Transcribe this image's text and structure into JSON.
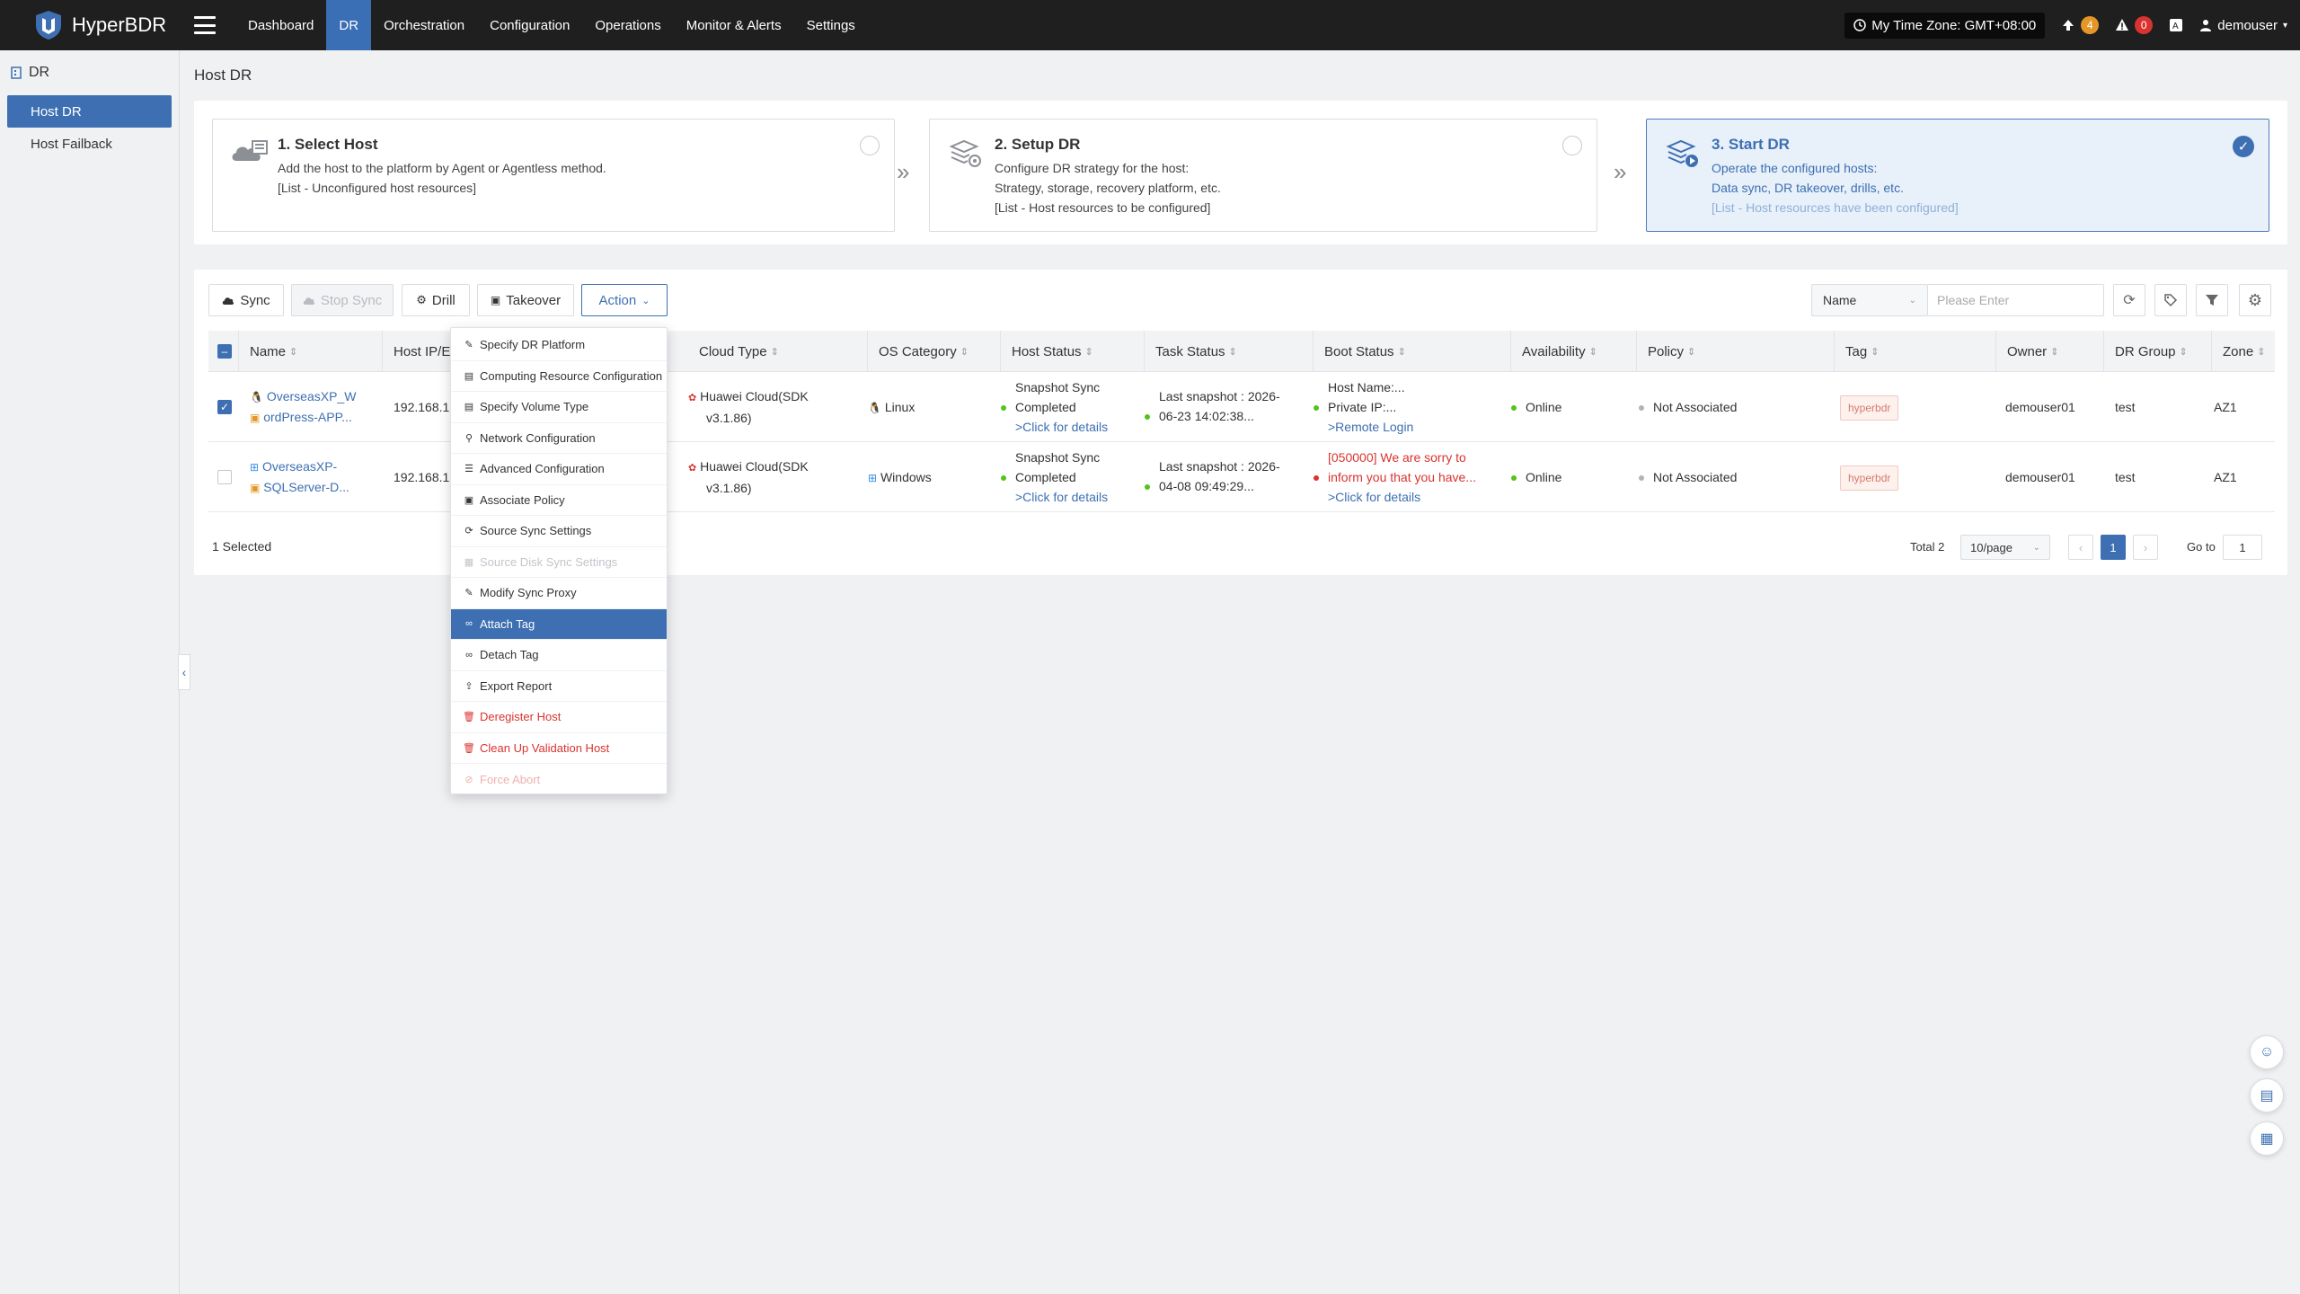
{
  "app": {
    "title": "HyperBDR"
  },
  "nav": [
    {
      "label": "Dashboard"
    },
    {
      "label": "DR"
    },
    {
      "label": "Orchestration"
    },
    {
      "label": "Configuration"
    },
    {
      "label": "Operations"
    },
    {
      "label": "Monitor & Alerts"
    },
    {
      "label": "Settings"
    }
  ],
  "header": {
    "timezone": "My Time Zone: GMT+08:00",
    "upload_count": "4",
    "alert_count": "0",
    "user": "demouser"
  },
  "sidebar": {
    "section": "DR",
    "items": [
      {
        "label": "Host DR"
      },
      {
        "label": "Host Failback"
      }
    ]
  },
  "page": {
    "title": "Host DR"
  },
  "steps": [
    {
      "title": "1. Select Host",
      "lines": [
        "Add the host to the platform by Agent or Agentless method.",
        "[List - Unconfigured host resources]"
      ]
    },
    {
      "title": "2. Setup DR",
      "lines": [
        "Configure DR strategy for the host:",
        "Strategy, storage, recovery platform, etc.",
        "[List - Host resources to be configured]"
      ]
    },
    {
      "title": "3. Start DR",
      "lines": [
        "Operate the configured hosts:",
        "Data sync, DR takeover, drills, etc.",
        "[List - Host resources have been configured]"
      ]
    }
  ],
  "toolbar": {
    "sync": "Sync",
    "stop_sync": "Stop Sync",
    "drill": "Drill",
    "takeover": "Takeover",
    "action": "Action",
    "filter_field": "Name",
    "search_placeholder": "Please Enter"
  },
  "table": {
    "columns": [
      "Name",
      "Host IP/ESXi",
      "Cloud Type",
      "OS Category",
      "Host Status",
      "Task Status",
      "Boot Status",
      "Availability",
      "Policy",
      "Tag",
      "Owner",
      "DR Group",
      "Zone"
    ],
    "rows": [
      {
        "checked": true,
        "name_line1": "OverseasXP_W",
        "name_line2": "ordPress-APP...",
        "ip": "192.168.1",
        "cloud_line1": "Huawei Cloud(SDK",
        "cloud_line2": "v3.1.86)",
        "os": "Linux",
        "host_status_line1": "Snapshot Sync",
        "host_status_line2": "Completed",
        "host_status_link": ">Click for details",
        "task_line1": "Last snapshot : 2026-",
        "task_line2": "06-23 14:02:38...",
        "boot_line1": "Host Name:...",
        "boot_line2": "Private IP:...",
        "boot_link": ">Remote Login",
        "availability": "Online",
        "policy": "Not Associated",
        "tag": "hyperbdr",
        "owner": "demouser01",
        "group": "test",
        "zone": "AZ1"
      },
      {
        "checked": false,
        "name_line1": "OverseasXP-",
        "name_line2": "SQLServer-D...",
        "ip": "192.168.1",
        "cloud_line1": "Huawei Cloud(SDK",
        "cloud_line2": "v3.1.86)",
        "os": "Windows",
        "host_status_line1": "Snapshot Sync",
        "host_status_line2": "Completed",
        "host_status_link": ">Click for details",
        "task_line1": "Last snapshot : 2026-",
        "task_line2": "04-08 09:49:29...",
        "boot_line1": "[050000] We are sorry to",
        "boot_line2": "inform you that you have...",
        "boot_link": ">Click for details",
        "availability": "Online",
        "policy": "Not Associated",
        "tag": "hyperbdr",
        "owner": "demouser01",
        "group": "test",
        "zone": "AZ1"
      }
    ]
  },
  "footer": {
    "selected": "1 Selected",
    "total": "Total 2",
    "page_size": "10/page",
    "current_page": "1",
    "goto_label": "Go to",
    "goto_value": "1"
  },
  "action_menu": [
    {
      "label": "Specify DR Platform",
      "icon": "edit-icon"
    },
    {
      "label": "Computing Resource Configuration",
      "icon": "server-icon"
    },
    {
      "label": "Specify Volume Type",
      "icon": "disk-icon"
    },
    {
      "label": "Network Configuration",
      "icon": "network-icon"
    },
    {
      "label": "Advanced Configuration",
      "icon": "sliders-icon"
    },
    {
      "label": "Associate Policy",
      "icon": "policy-icon"
    },
    {
      "label": "Source Sync Settings",
      "icon": "sync-settings-icon"
    },
    {
      "label": "Source Disk Sync Settings",
      "icon": "disk-sync-icon"
    },
    {
      "label": "Modify Sync Proxy",
      "icon": "proxy-icon"
    },
    {
      "label": "Attach Tag",
      "icon": "link-icon"
    },
    {
      "label": "Detach Tag",
      "icon": "unlink-icon"
    },
    {
      "label": "Export Report",
      "icon": "export-icon"
    },
    {
      "label": "Deregister Host",
      "icon": "trash-icon"
    },
    {
      "label": "Clean Up Validation Host",
      "icon": "trash-icon"
    },
    {
      "label": "Force Abort",
      "icon": "abort-icon"
    }
  ],
  "colors": {
    "accent": "#3d6fb2",
    "topbar": "#1f1f1f",
    "danger": "#d9332f",
    "success": "#52c41a"
  }
}
